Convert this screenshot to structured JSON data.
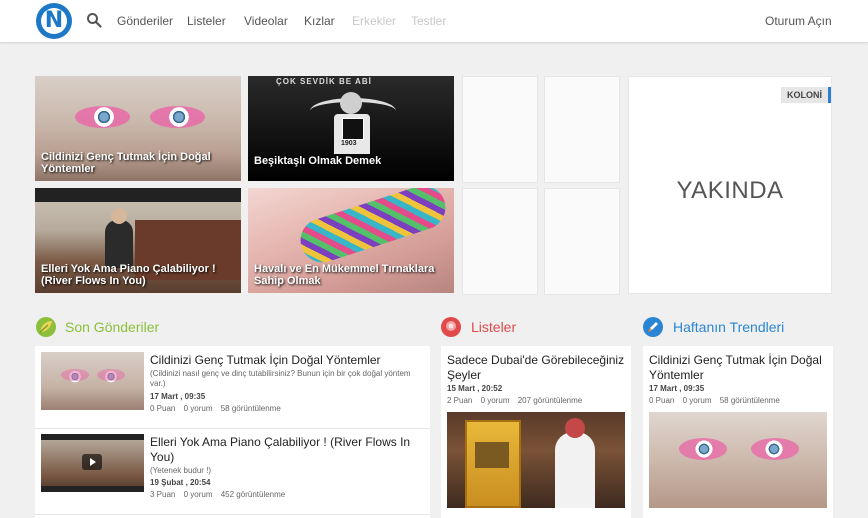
{
  "header": {
    "logo_letter": "N",
    "nav": [
      "Gönderiler",
      "Listeler",
      "Videolar",
      "Kızlar",
      "Erkekler",
      "Testler"
    ],
    "login": "Oturum Açın"
  },
  "featured": [
    {
      "caption": "Cildinizi Genç Tutmak İçin Doğal Yöntemler"
    },
    {
      "caption": "Beşiktaşlı Olmak Demek",
      "banner": "ÇOK SEVDİK BE ABİ",
      "year": "1903"
    },
    {
      "caption": "Elleri Yok Ama Piano Çalabiliyor ! (River Flows In You)"
    },
    {
      "caption": "Havalı ve En Mükemmel Tırnaklara Sahip Olmak"
    }
  ],
  "panel": {
    "badge": "KOLONİ",
    "text": "YAKINDA"
  },
  "sections": {
    "son": {
      "title": "Son Gönderiler",
      "color": "#8bbf3c",
      "items": [
        {
          "title": "Cildinizi Genç Tutmak İçin Doğal Yöntemler",
          "sub": "(Cildinizi nasıl genç ve dinç tutabilirsiniz? Bunun için bir çok doğal yöntem var.)",
          "date": "17 Mart , 09:35",
          "points": "0 Puan",
          "comments": "0 yorum",
          "views": "58 görüntülenme"
        },
        {
          "title": "Elleri Yok Ama Piano Çalabiliyor ! (River Flows In You)",
          "sub": "(Yetenek budur !)",
          "date": "19 Şubat , 20:54",
          "points": "3 Puan",
          "comments": "0 yorum",
          "views": "452 görüntülenme"
        }
      ]
    },
    "listeler": {
      "title": "Listeler",
      "color": "#e04a4a",
      "item": {
        "title": "Sadece Dubai'de Görebileceğiniz Şeyler",
        "date": "15 Mart , 20:52",
        "points": "2 Puan",
        "comments": "0 yorum",
        "views": "207 görüntülenme"
      }
    },
    "trend": {
      "title": "Haftanın Trendleri",
      "color": "#2a86d4",
      "item": {
        "title": "Cildinizi Genç Tutmak İçin Doğal Yöntemler",
        "date": "17 Mart , 09:35",
        "points": "0 Puan",
        "comments": "0 yorum",
        "views": "58 görüntülenme"
      }
    }
  }
}
